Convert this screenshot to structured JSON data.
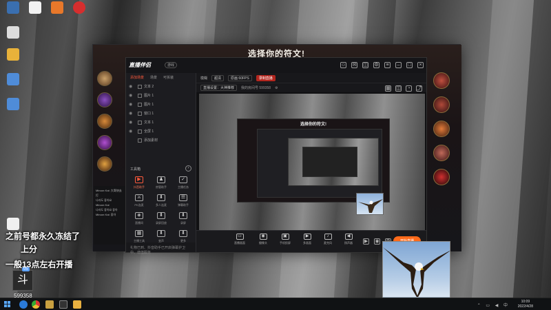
{
  "game": {
    "title": "选择你的符文!"
  },
  "nested_game": {
    "title": "选择你的符文!"
  },
  "streamer": {
    "logo": "直播伴侣",
    "logo_badge": "游戏"
  },
  "left_pane": {
    "tabs": [
      {
        "label": "添加场景",
        "active": true
      },
      {
        "label": "场景",
        "active": false
      },
      {
        "label": "可拆装",
        "active": false
      }
    ],
    "scenes": [
      {
        "label": "文本 2"
      },
      {
        "label": "图片 1"
      },
      {
        "label": "图片 1"
      },
      {
        "label": "窗口 1"
      },
      {
        "label": "文本 1"
      },
      {
        "label": "全屏 1"
      },
      {
        "label": "添加素材"
      }
    ],
    "tools_title": "工具箱",
    "tools_more": "›",
    "tools": [
      {
        "label": "抖音助手",
        "glyph": "▶",
        "hot": true
      },
      {
        "label": "房管助手",
        "glyph": "♟",
        "hot": false
      },
      {
        "label": "主播任务",
        "glyph": "✓",
        "hot": false
      },
      {
        "label": "PK连麦",
        "glyph": "⚔",
        "hot": false
      },
      {
        "label": "多人连麦",
        "glyph": "⬇",
        "hot": false
      },
      {
        "label": "弹幕助手",
        "glyph": "☰",
        "hot": false
      },
      {
        "label": "直播间",
        "glyph": "◈",
        "hot": false
      },
      {
        "label": "录屏回放",
        "glyph": "⬇",
        "hot": false
      },
      {
        "label": "录屏",
        "glyph": "⬇",
        "hot": false
      },
      {
        "label": "主播工具",
        "glyph": "▦",
        "hot": false
      },
      {
        "label": "变声",
        "glyph": "⬇",
        "hot": false
      },
      {
        "label": "更多",
        "glyph": "⬇",
        "hot": false
      }
    ],
    "status": "礼物已到、抖音助手已开启弹幕护卫中、增值服务"
  },
  "center": {
    "row1": {
      "device": "模糊",
      "quality": "超清",
      "option": "原画 60FPS",
      "record_label": "录制直播"
    },
    "row2": {
      "stream_info": "直播设置：大神推荐",
      "audience": "我的房间号 599358",
      "online_icon": "⚙"
    }
  },
  "bottom_bar": {
    "buttons": [
      {
        "label": "直播画面",
        "glyph": "▭"
      },
      {
        "label": "摄像头",
        "glyph": "◉"
      },
      {
        "label": "手机投屏",
        "glyph": "▣"
      },
      {
        "label": "多画面",
        "glyph": "▶"
      },
      {
        "label": "麦克风",
        "glyph": "♪"
      },
      {
        "label": "扬声器",
        "glyph": "◀"
      }
    ],
    "start_live": "开始直播"
  },
  "chat": {
    "lines": [
      "Minozx Kai: 大哥快去打",
      "나라도 좋아요",
      "Minozx Kai",
      "나라도 좋아요 좋아",
      "Minozx Kai: 좋아"
    ]
  },
  "overlays": {
    "line1": "之前号都永久冻结了",
    "line2": "上分",
    "line3": "一般13点左右开播",
    "badge": "05",
    "avatar_text": "斗",
    "room_number": "599358"
  },
  "taskbar": {
    "time": "10:09",
    "date": "2022/4/28",
    "tray": "⌃ ▭ ◀ 中"
  },
  "colors": {
    "accent": "#ff5a3c",
    "live": "#ff6a1a",
    "record": "#b3261e"
  }
}
